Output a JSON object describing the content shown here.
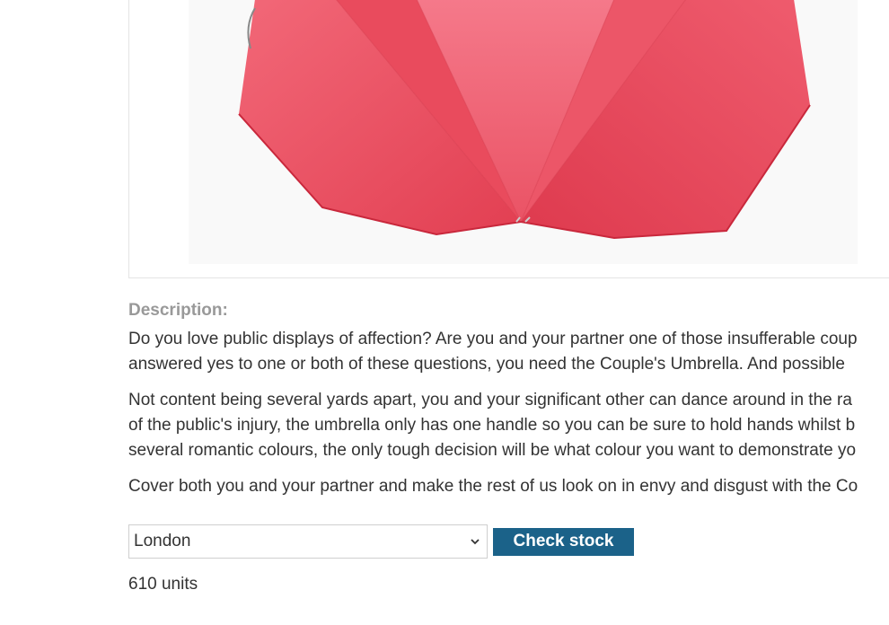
{
  "product": {
    "image_alt": "Couple's Umbrella",
    "description_label": "Description:",
    "paragraphs": [
      {
        "lines": [
          "Do you love public displays of affection? Are you and your partner one of those insufferable coup",
          "answered yes to one or both of these questions, you need the Couple's Umbrella. And possible"
        ]
      },
      {
        "lines": [
          "Not content being several yards apart, you and your significant other can dance around in the ra",
          "of the public's injury, the umbrella only has one handle so you can be sure to hold hands whilst b",
          "several romantic colours, the only tough decision will be what colour you want to demonstrate yo"
        ]
      },
      {
        "lines": [
          "Cover both you and your partner and make the rest of us look on in envy and disgust with the Co"
        ]
      }
    ]
  },
  "stock_check": {
    "store_selected": "London",
    "button_label": "Check stock",
    "result": "610 units"
  },
  "colors": {
    "umbrella": "#ee4d5e",
    "button": "#1b6289"
  },
  "icons": {
    "select_arrow": "chevron-down-icon"
  }
}
